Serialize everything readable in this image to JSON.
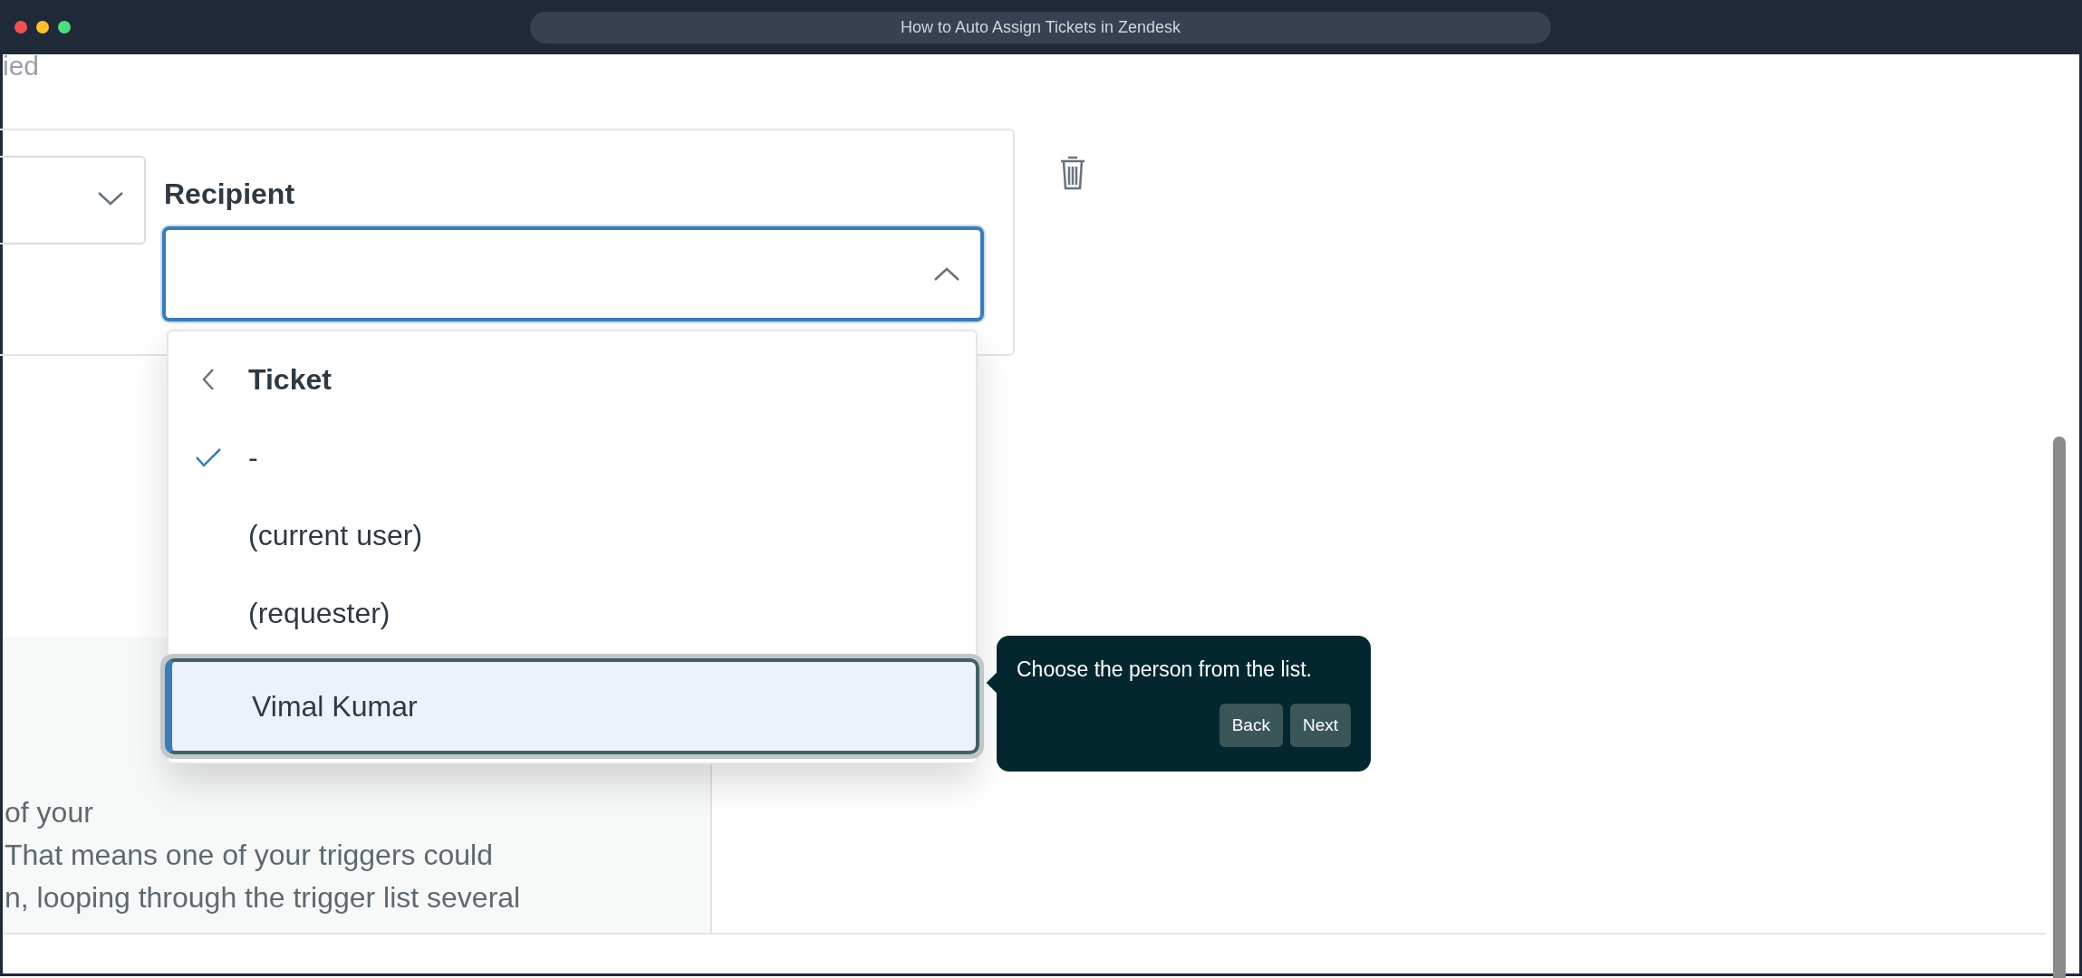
{
  "window": {
    "title": "How to Auto Assign Tickets in Zendesk"
  },
  "page": {
    "cut_text": "ied"
  },
  "condition": {
    "field_label": "Recipient",
    "expanded": true
  },
  "dropdown": {
    "header": "Ticket",
    "options": [
      {
        "label": "-",
        "selected": true,
        "highlighted": false
      },
      {
        "label": "(current user)",
        "selected": false,
        "highlighted": false
      },
      {
        "label": "(requester)",
        "selected": false,
        "highlighted": false
      },
      {
        "label": "Vimal Kumar",
        "selected": false,
        "highlighted": true
      }
    ]
  },
  "info_panel": {
    "lines": [
      "of your",
      "That means one of your triggers could",
      "n, looping through the trigger list several"
    ]
  },
  "tooltip": {
    "text": "Choose the person from the list.",
    "buttons": [
      "Back",
      "Next"
    ]
  }
}
